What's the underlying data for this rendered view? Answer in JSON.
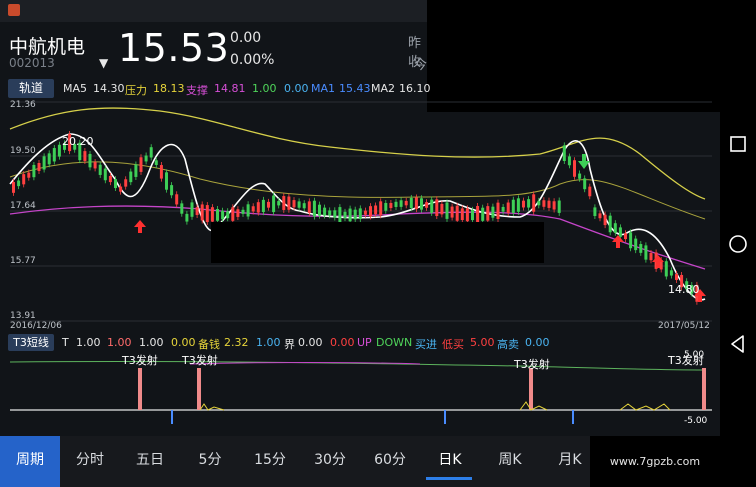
{
  "header": {
    "name": "中航机电",
    "code": "002013",
    "price": "15.53",
    "change": "0.00",
    "change_pct": "0.00%",
    "trend_arrow": "▼",
    "cut_label_1": "昨收",
    "cut_label_2": "今"
  },
  "main_indicator": {
    "tag": "轨道",
    "items": [
      {
        "label": "MA5",
        "value": "14.30",
        "color": "#e6e6e6"
      },
      {
        "label": "压力",
        "value": "18.13",
        "color": "#e6d43a"
      },
      {
        "label": "支撑",
        "value": "14.81",
        "color": "#d64fd6"
      },
      {
        "label": "",
        "value": "1.00",
        "color": "#4fd45a"
      },
      {
        "label": "",
        "value": "0.00",
        "color": "#4ab3f0"
      },
      {
        "label": "MA1",
        "value": "15.43",
        "color": "#4a8cff"
      },
      {
        "label": "MA2",
        "value": "16.10",
        "color": "#e6e6e6"
      }
    ]
  },
  "main_chart": {
    "y_ticks": [
      "21.36",
      "19.50",
      "17.64",
      "15.77",
      "13.91"
    ],
    "date_start": "2016/12/06",
    "date_end": "2017/05/12",
    "high_label": "20.20",
    "low_label": "14.80"
  },
  "sub_indicator": {
    "tag": "T3短线",
    "items": [
      {
        "label": "T",
        "value": "1.00",
        "color": "#e6e6e6"
      },
      {
        "label": "",
        "value": "1.00",
        "color": "#ff6b6b"
      },
      {
        "label": "",
        "value": "1.00",
        "color": "#e6e6e6"
      },
      {
        "label": "",
        "value": "0.00",
        "color": "#e6d43a"
      },
      {
        "label": "备钱",
        "value": "2.32",
        "color": "#e6d43a"
      },
      {
        "label": "",
        "value": "1.00",
        "color": "#4ab3f0"
      },
      {
        "label": "界",
        "value": "0.00",
        "color": "#e6e6e6"
      },
      {
        "label": "",
        "value": "0.00",
        "color": "#ff4040"
      },
      {
        "label": "UP",
        "value": "",
        "color": "#d64fd6"
      },
      {
        "label": "DOWN",
        "value": "",
        "color": "#4fd45a"
      },
      {
        "label": "买进",
        "value": "",
        "color": "#4ab3f0"
      },
      {
        "label": "低买",
        "value": "5.00",
        "color": "#ff4040"
      },
      {
        "label": "高卖",
        "value": "0.00",
        "color": "#4ab3f0"
      }
    ],
    "signal_label": "T3发射",
    "top_value": "5.00",
    "bottom_value": "-5.00"
  },
  "tabs": [
    "周期",
    "分时",
    "五日",
    "5分",
    "15分",
    "30分",
    "60分",
    "日K",
    "周K",
    "月K"
  ],
  "selected_tab": "日K",
  "watermark": "www.7gpzb.com",
  "colors": {
    "up": "#ff4040",
    "down": "#3ecf57",
    "resistance": "#e6d43a",
    "support": "#d64fd6",
    "accent": "#2563c9"
  }
}
